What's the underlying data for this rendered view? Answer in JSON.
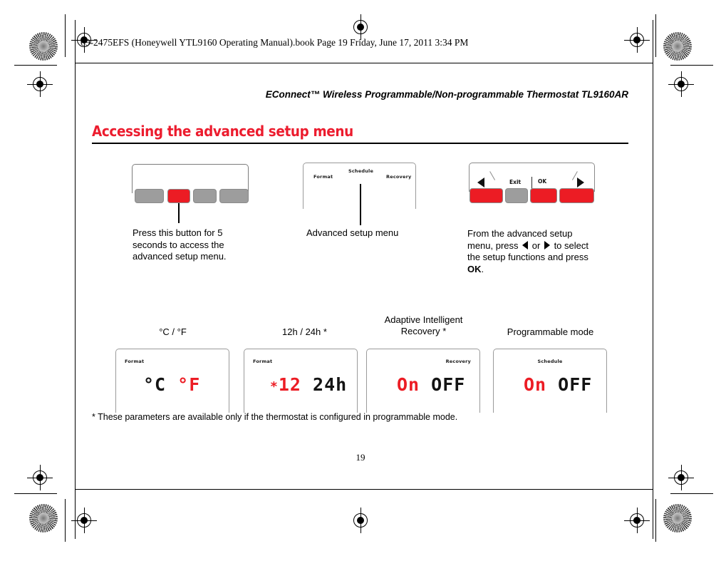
{
  "print_marks": {
    "book_line": "69-2475EFS (Honeywell YTL9160 Operating Manual).book  Page 19  Friday, June 17, 2011  3:34 PM"
  },
  "document": {
    "running_head": "EConnect™ Wireless Programmable/Non-programmable Thermostat TL9160AR",
    "heading": "Accessing the advanced setup menu",
    "page_number": "19",
    "footnote": "* These parameters are available only if the thermostat is configured in programmable mode."
  },
  "colors": {
    "accent_red": "#ec1c2e",
    "lcd_red": "#ec1c24",
    "button_grey": "#9d9d9d",
    "lcd_black": "#141414"
  },
  "figures": {
    "keypad_left": {
      "caption": "Press this button for 5 seconds to access the advanced setup menu.",
      "buttons": [
        {
          "name": "button-1",
          "color": "grey"
        },
        {
          "name": "button-2-highlighted",
          "color": "red"
        },
        {
          "name": "button-3",
          "color": "grey"
        },
        {
          "name": "button-4",
          "color": "grey"
        }
      ]
    },
    "lcd_menu": {
      "caption": "Advanced setup menu",
      "labels": {
        "format": "Format",
        "schedule": "Schedule",
        "recovery": "Recovery"
      }
    },
    "keypad_right": {
      "caption_part1": "From the advanced setup menu, press ",
      "caption_or": " or ",
      "caption_part2": " to select the setup functions and press ",
      "caption_ok": "OK",
      "caption_end": ".",
      "face_labels": {
        "exit": "Exit",
        "ok": "OK"
      },
      "buttons": [
        {
          "name": "left-arrow-button",
          "color": "red"
        },
        {
          "name": "exit-button",
          "color": "grey"
        },
        {
          "name": "ok-button",
          "color": "red"
        },
        {
          "name": "right-arrow-button",
          "color": "red"
        }
      ]
    }
  },
  "settings": [
    {
      "title": "°C / °F",
      "title_line2": "",
      "lcd_label": "Format",
      "lcd_label_pos": "left",
      "value_selected": "°C",
      "value_other": "°F",
      "selected_is_red": false,
      "prefix": ""
    },
    {
      "title": "12h / 24h *",
      "title_line2": "",
      "lcd_label": "Format",
      "lcd_label_pos": "left",
      "value_selected": "12",
      "value_other": "24h",
      "selected_is_red": true,
      "prefix": "*"
    },
    {
      "title": "Adaptive Intelligent",
      "title_line2": "Recovery *",
      "lcd_label": "Recovery",
      "lcd_label_pos": "right",
      "value_selected": "On",
      "value_other": "OFF",
      "selected_is_red": true,
      "prefix": ""
    },
    {
      "title": "Programmable mode",
      "title_line2": "",
      "lcd_label": "Schedule",
      "lcd_label_pos": "center",
      "value_selected": "On",
      "value_other": "OFF",
      "selected_is_red": true,
      "prefix": ""
    }
  ]
}
